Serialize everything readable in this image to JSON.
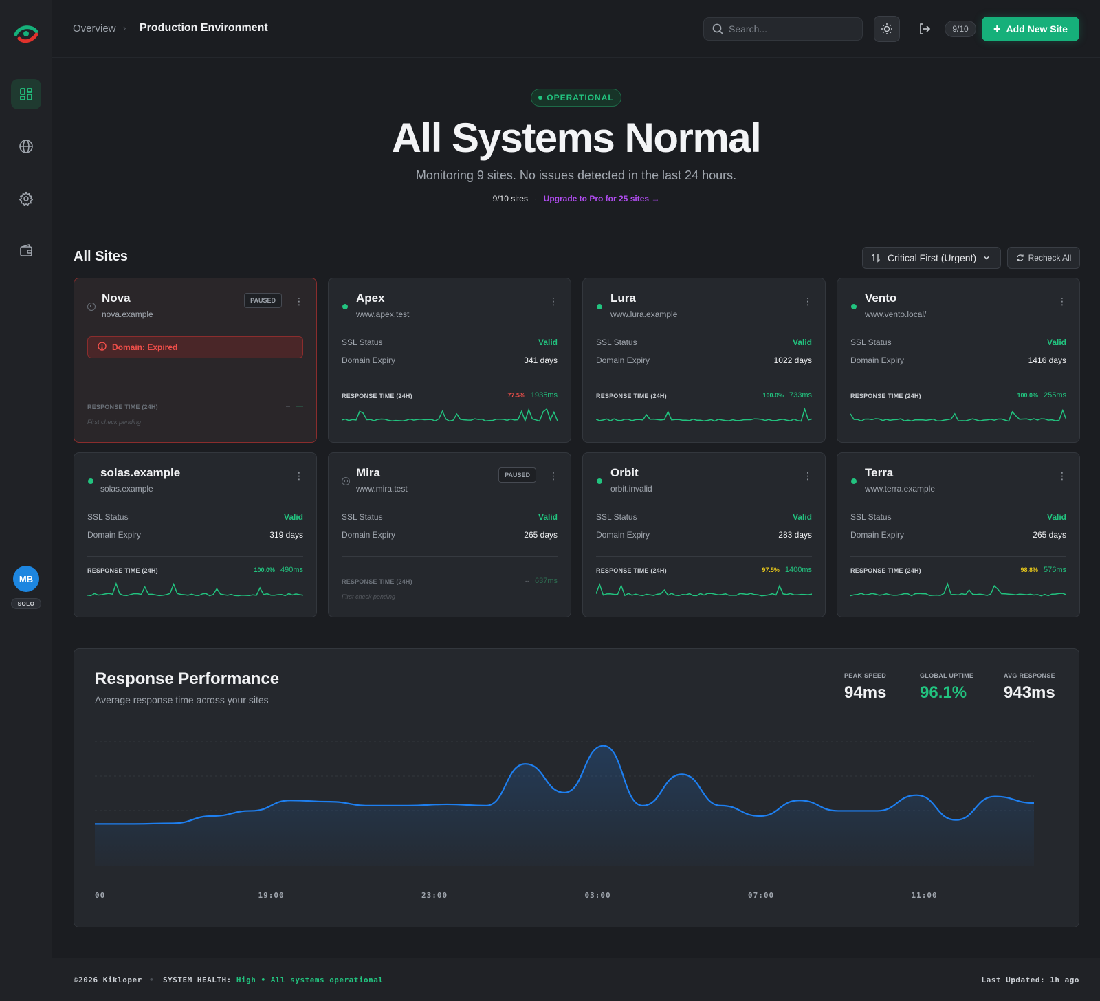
{
  "header": {
    "breadcrumb": [
      "Overview",
      "Production Environment"
    ],
    "search_placeholder": "Search...",
    "site_count": "9/10",
    "add_button": "Add New Site"
  },
  "hero": {
    "badge": "OPERATIONAL",
    "title": "All Systems Normal",
    "subtitle": "Monitoring 9 sites. No issues detected in the last 24 hours.",
    "sites_used": "9/10 sites",
    "upgrade": "Upgrade to Pro for 25 sites →"
  },
  "sites_section": {
    "title": "All Sites",
    "sort": "Critical First (Urgent)",
    "recheck": "Recheck All"
  },
  "labels": {
    "ssl": "SSL Status",
    "expiry": "Domain Expiry",
    "response": "RESPONSE TIME (24H)",
    "pending": "First check pending",
    "paused": "PAUSED",
    "expired": "Domain: Expired"
  },
  "cards": [
    {
      "name": "Nova",
      "domain": "nova.example",
      "paused": true,
      "expired": true,
      "pct": "--",
      "ms": "—"
    },
    {
      "name": "Apex",
      "domain": "www.apex.test",
      "ssl": "Valid",
      "expiry": "341 days",
      "pct": "77.5%",
      "ms": "1935ms",
      "pct_color": "#f04f4a"
    },
    {
      "name": "Lura",
      "domain": "www.lura.example",
      "ssl": "Valid",
      "expiry": "1022 days",
      "pct": "100.0%",
      "ms": "733ms",
      "pct_color": "#22c37f"
    },
    {
      "name": "Vento",
      "domain": "www.vento.local/",
      "ssl": "Valid",
      "expiry": "1416 days",
      "pct": "100.0%",
      "ms": "255ms",
      "pct_color": "#22c37f"
    },
    {
      "name": "solas.example",
      "domain": "solas.example",
      "ssl": "Valid",
      "expiry": "319 days",
      "pct": "100.0%",
      "ms": "490ms",
      "pct_color": "#22c37f"
    },
    {
      "name": "Mira",
      "domain": "www.mira.test",
      "paused": true,
      "ssl": "Valid",
      "expiry": "265 days",
      "pct": "--",
      "ms": "637ms"
    },
    {
      "name": "Orbit",
      "domain": "orbit.invalid",
      "ssl": "Valid",
      "expiry": "283 days",
      "pct": "97.5%",
      "ms": "1400ms",
      "pct_color": "#e8c81a"
    },
    {
      "name": "Terra",
      "domain": "www.terra.example",
      "ssl": "Valid",
      "expiry": "265 days",
      "pct": "98.8%",
      "ms": "576ms",
      "pct_color": "#e8c81a"
    }
  ],
  "performance": {
    "title": "Response Performance",
    "subtitle": "Average response time across your sites",
    "stats": [
      {
        "label": "PEAK SPEED",
        "value": "94ms",
        "color": "#f1f2f4"
      },
      {
        "label": "GLOBAL UPTIME",
        "value": "96.1%",
        "color": "#22c37f"
      },
      {
        "label": "AVG RESPONSE",
        "value": "943ms",
        "color": "#f1f2f4"
      }
    ]
  },
  "chart_data": {
    "type": "area",
    "x_tick_labels": [
      "00",
      "19:00",
      "23:00",
      "03:00",
      "07:00",
      "11:00"
    ],
    "values": [
      620,
      620,
      625,
      680,
      720,
      800,
      790,
      760,
      760,
      770,
      760,
      1080,
      860,
      1220,
      760,
      1000,
      760,
      680,
      800,
      720,
      720,
      840,
      650,
      830,
      780
    ],
    "color": "#1e7ff0"
  },
  "footer": {
    "copyright": "©2026 Kikloper",
    "health_label": "SYSTEM HEALTH:",
    "health_value": "High",
    "health_note": "All systems operational",
    "updated": "Last Updated: 1h ago"
  }
}
